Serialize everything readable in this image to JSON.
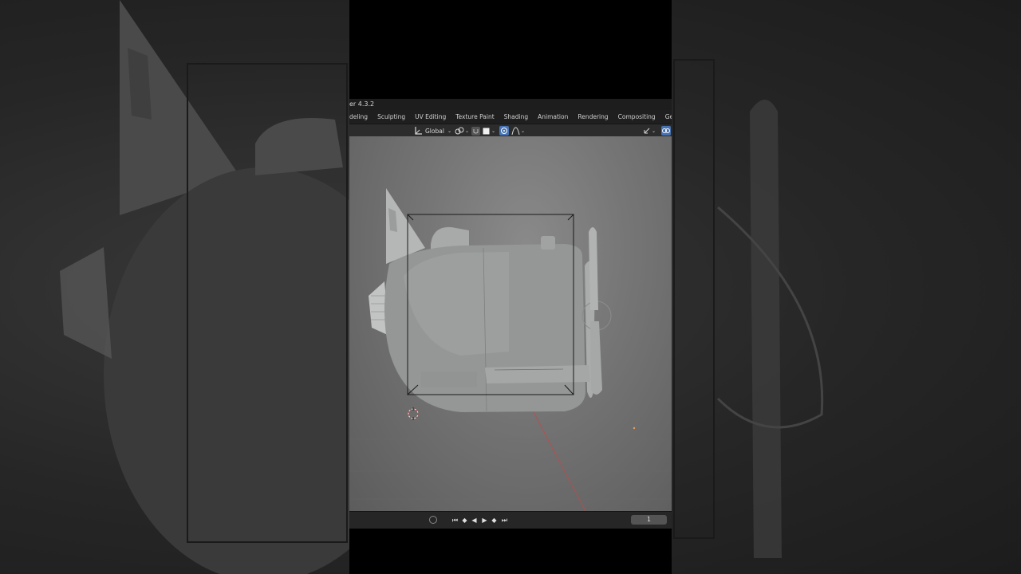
{
  "app": {
    "title": "er 4.3.2"
  },
  "workspaces": {
    "tabs": [
      {
        "label": "deling"
      },
      {
        "label": "Sculpting"
      },
      {
        "label": "UV Editing"
      },
      {
        "label": "Texture Paint"
      },
      {
        "label": "Shading"
      },
      {
        "label": "Animation"
      },
      {
        "label": "Rendering"
      },
      {
        "label": "Compositing"
      },
      {
        "label": "Geometry Node"
      }
    ]
  },
  "header": {
    "orientation_label": "Global",
    "icons": [
      "transform-orientation-icon",
      "pivot-icon",
      "snap-icon",
      "proportional-edit-icon",
      "falloff-icon",
      "gizmo-icon",
      "overlay-icon"
    ]
  },
  "viewport": {
    "object": "cartoon airplane",
    "colors": {
      "background": "#767676",
      "model": "#8e918f",
      "selection_box": "#1a1a1a",
      "x_axis": "#c04a4a",
      "cursor": "#c24d4d"
    }
  },
  "timeline": {
    "current_frame": "1",
    "controls": [
      "jump-start-icon",
      "jump-prev-keyframe-icon",
      "play-reverse-icon",
      "play-icon",
      "jump-next-keyframe-icon",
      "jump-end-icon"
    ]
  }
}
